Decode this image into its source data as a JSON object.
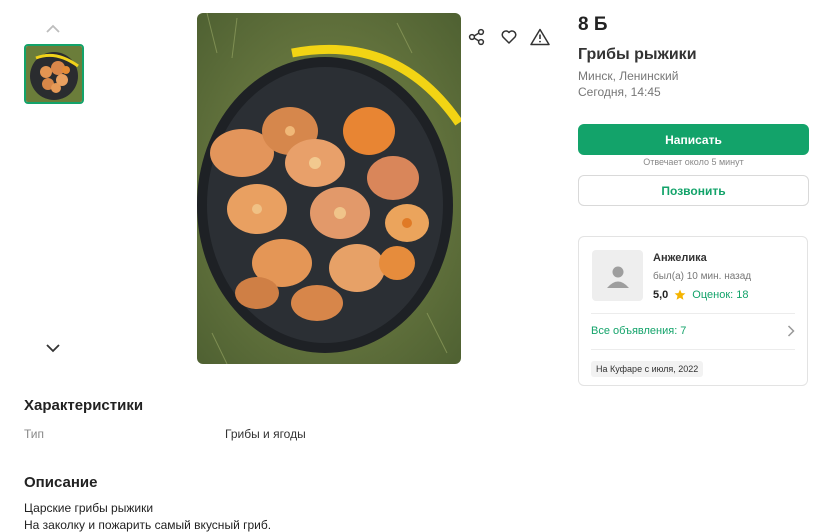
{
  "listing": {
    "price": "8 Б",
    "title": "Грибы рыжики",
    "location": "Минск, Ленинский",
    "date": "Сегодня, 14:45"
  },
  "actions": {
    "write_label": "Написать",
    "reply_note": "Отвечает около 5 минут",
    "call_label": "Позвонить"
  },
  "seller": {
    "name": "Анжелика",
    "last_seen": "был(а) 10 мин. назад",
    "rating": "5,0",
    "reviews": "Оценок: 18",
    "all_ads": "Все объявления: 7",
    "member_since": "На Куфаре с июля, 2022"
  },
  "characteristics": {
    "heading": "Характеристики",
    "rows": [
      {
        "key": "Тип",
        "value": "Грибы и ягоды"
      }
    ]
  },
  "description": {
    "heading": "Описание",
    "lines": [
      "Царские грибы рыжики",
      "На заколку и пожарить самый вкусный гриб."
    ]
  },
  "colors": {
    "accent": "#13a36a",
    "star": "#f5b400"
  },
  "icons": [
    "chevron-up-icon",
    "chevron-down-icon",
    "share-icon",
    "heart-icon",
    "warning-icon",
    "user-icon",
    "star-icon",
    "chevron-right-icon"
  ]
}
